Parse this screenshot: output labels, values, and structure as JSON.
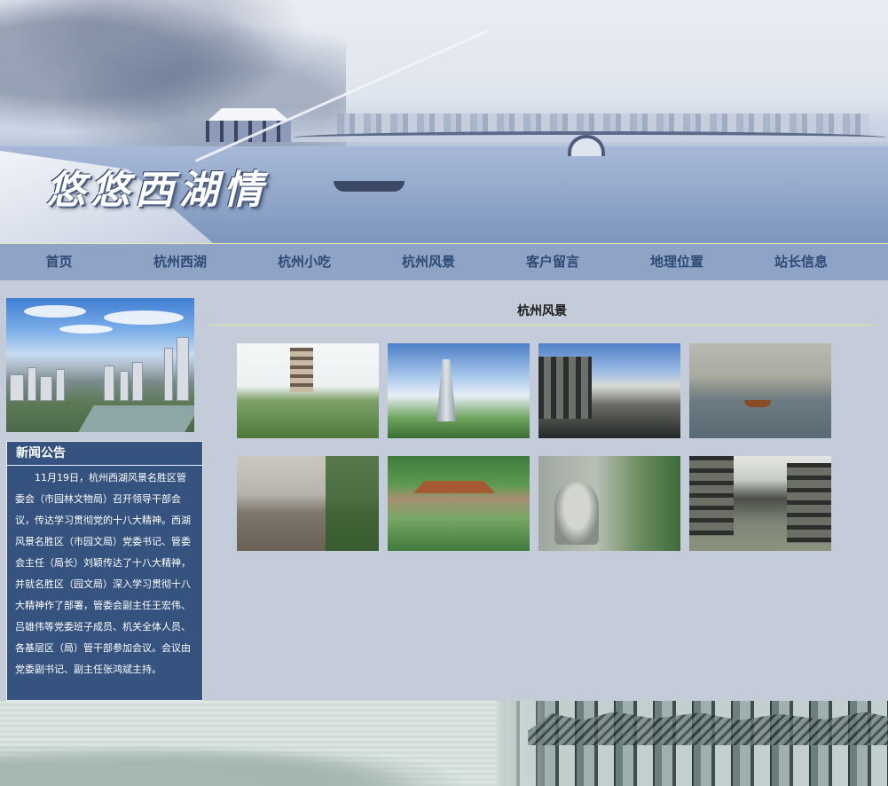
{
  "banner": {
    "title": "悠悠西湖情"
  },
  "nav": {
    "items": [
      {
        "label": "首页"
      },
      {
        "label": "杭州西湖"
      },
      {
        "label": "杭州小吃"
      },
      {
        "label": "杭州风景"
      },
      {
        "label": "客户留言"
      },
      {
        "label": "地理位置"
      },
      {
        "label": "站长信息"
      }
    ]
  },
  "news": {
    "title": "新闻公告",
    "body": "11月19日，杭州西湖风景名胜区管委会（市园林文物局）召开领导干部会议，传达学习贯彻党的十八大精神。西湖风景名胜区（市园文局）党委书记、管委会主任（局长）刘颖传达了十八大精神，并就名胜区（园文局）深入学习贯彻十八大精神作了部署，管委会副主任王宏伟、吕雄伟等党委班子成员、机关全体人员、各基层区（局）管干部参加会议。会议由党委副书记、副主任张鸿斌主持。"
  },
  "main": {
    "title": "杭州风景"
  },
  "colors": {
    "page_bg": "#c5ccd9",
    "nav_bg": "#8fa3c6",
    "nav_text": "#2e4a75",
    "news_bg": "#36527f",
    "divider": "#e4e49a"
  }
}
